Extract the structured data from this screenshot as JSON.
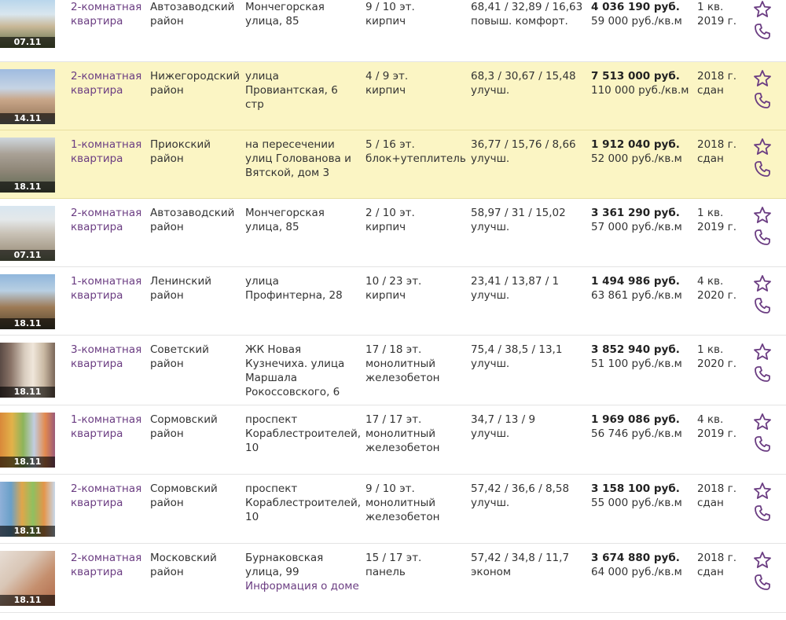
{
  "colors": {
    "accent": "#6b3d82",
    "highlight_bg": "#fbf5c4",
    "text": "#333333"
  },
  "rows": [
    {
      "date": "07.11",
      "type": "2-комнатная квартира",
      "district": "Автозаводский район",
      "address": "Мончегорская улица, 85",
      "floor": "9 / 10 эт.",
      "material": "кирпич",
      "area": "68,41 / 32,89 / 16,63",
      "finish": "повыш. комфорт.",
      "price": "4 036 190 руб.",
      "price_per_m2": "59 000 руб./кв.м",
      "completion": "1 кв. 2019 г.",
      "highlighted": false
    },
    {
      "date": "14.11",
      "type": "2-комнатная квартира",
      "district": "Нижегородский район",
      "address": "улица Провиантская, 6 стр",
      "floor": "4 / 9 эт.",
      "material": "кирпич",
      "area": "68,3 / 30,67 / 15,48",
      "finish": "улучш.",
      "price": "7 513 000 руб.",
      "price_per_m2": "110 000 руб./кв.м",
      "completion": "2018 г. сдан",
      "highlighted": true
    },
    {
      "date": "18.11",
      "type": "1-комнатная квартира",
      "district": "Приокский район",
      "address": "на пересечении улиц Голованова и Вятской, дом 3",
      "floor": "5 / 16 эт.",
      "material": "блок+утеплитель",
      "area": "36,77 / 15,76 / 8,66",
      "finish": "улучш.",
      "price": "1 912 040 руб.",
      "price_per_m2": "52 000 руб./кв.м",
      "completion": "2018 г. сдан",
      "highlighted": true
    },
    {
      "date": "07.11",
      "type": "2-комнатная квартира",
      "district": "Автозаводский район",
      "address": "Мончегорская улица, 85",
      "floor": "2 / 10 эт.",
      "material": "кирпич",
      "area": "58,97 / 31 / 15,02",
      "finish": "улучш.",
      "price": "3 361 290 руб.",
      "price_per_m2": "57 000 руб./кв.м",
      "completion": "1 кв. 2019 г.",
      "highlighted": false
    },
    {
      "date": "18.11",
      "type": "1-комнатная квартира",
      "district": "Ленинский район",
      "address": "улица Профинтерна, 28",
      "floor": "10 / 23 эт.",
      "material": "кирпич",
      "area": "23,41 / 13,87 / 1",
      "finish": "улучш.",
      "price": "1 494 986 руб.",
      "price_per_m2": "63 861 руб./кв.м",
      "completion": "4 кв. 2020 г.",
      "highlighted": false
    },
    {
      "date": "18.11",
      "type": "3-комнатная квартира",
      "district": "Советский район",
      "address": "ЖК Новая Кузнечиха. улица Маршала Рокоссовского, 6",
      "floor": "17 / 18 эт.",
      "material": "монолитный железобетон",
      "area": "75,4 / 38,5 / 13,1",
      "finish": "улучш.",
      "price": "3 852 940 руб.",
      "price_per_m2": "51 100 руб./кв.м",
      "completion": "1 кв. 2020 г.",
      "highlighted": false
    },
    {
      "date": "18.11",
      "type": "1-комнатная квартира",
      "district": "Сормовский район",
      "address": "проспект Кораблестроителей, 10",
      "floor": "17 / 17 эт.",
      "material": "монолитный железобетон",
      "area": "34,7 / 13 / 9",
      "finish": "улучш.",
      "price": "1 969 086 руб.",
      "price_per_m2": "56 746 руб./кв.м",
      "completion": "4 кв. 2019 г.",
      "highlighted": false
    },
    {
      "date": "18.11",
      "type": "2-комнатная квартира",
      "district": "Сормовский район",
      "address": "проспект Кораблестроителей, 10",
      "floor": "9 / 10 эт.",
      "material": "монолитный железобетон",
      "area": "57,42 / 36,6 / 8,58",
      "finish": "улучш.",
      "price": "3 158 100 руб.",
      "price_per_m2": "55 000 руб./кв.м",
      "completion": "2018 г. сдан",
      "highlighted": false
    },
    {
      "date": "18.11",
      "type": "2-комнатная квартира",
      "district": "Московский район",
      "address": "Бурнаковская улица, 99",
      "info_link": "Информация о доме",
      "floor": "15 / 17 эт.",
      "material": "панель",
      "area": "57,42 / 34,8 / 11,7",
      "finish": "эконом",
      "price": "3 674 880 руб.",
      "price_per_m2": "64 000 руб./кв.м",
      "completion": "2018 г. сдан",
      "highlighted": false
    }
  ]
}
